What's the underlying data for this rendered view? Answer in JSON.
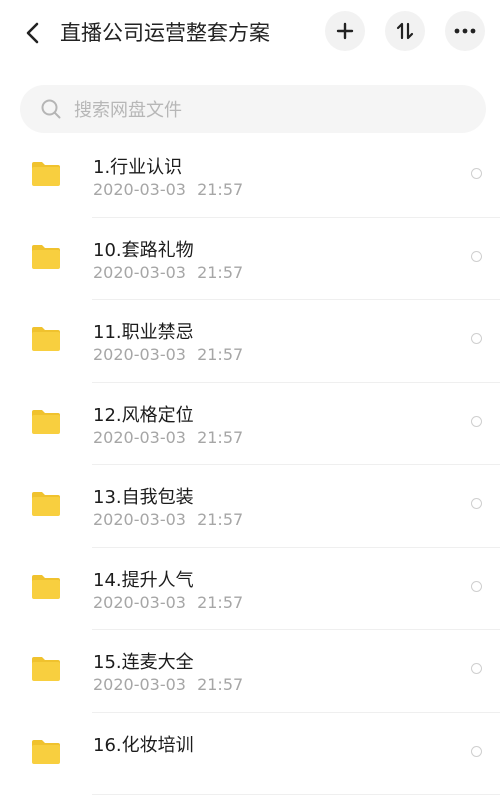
{
  "header": {
    "title": "直播公司运营整套方案",
    "back_icon": "chevron-left-icon",
    "add_icon": "plus-icon",
    "sort_icon": "sort-arrows-icon",
    "more_icon": "more-dots-icon"
  },
  "search": {
    "placeholder": "搜索网盘文件"
  },
  "files": [
    {
      "name": "1.行业认识",
      "date": "2020-03-03 21:57"
    },
    {
      "name": "10.套路礼物",
      "date": "2020-03-03 21:57"
    },
    {
      "name": "11.职业禁忌",
      "date": "2020-03-03 21:57"
    },
    {
      "name": "12.风格定位",
      "date": "2020-03-03 21:57"
    },
    {
      "name": "13.自我包装",
      "date": "2020-03-03 21:57"
    },
    {
      "name": "14.提升人气",
      "date": "2020-03-03 21:57"
    },
    {
      "name": "15.连麦大全",
      "date": "2020-03-03 21:57"
    },
    {
      "name": "16.化妆培训",
      "date": ""
    }
  ],
  "colors": {
    "folder": "#f8cf3f",
    "folder_tab": "#f0c22e",
    "date_text": "#a6a6a6",
    "button_bg": "#f2f2f2"
  }
}
